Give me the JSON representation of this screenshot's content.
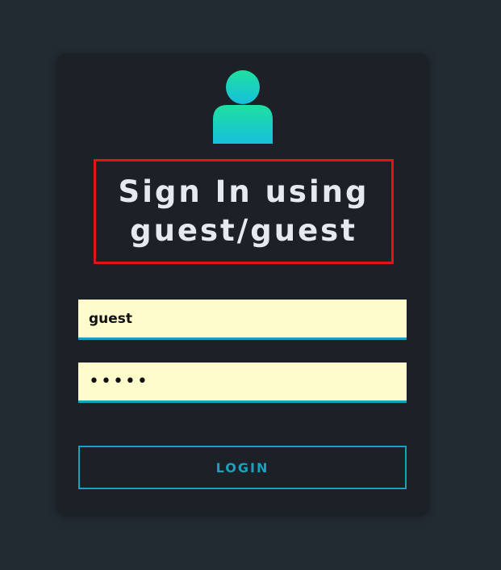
{
  "card": {
    "avatar_icon": "user-icon",
    "title_line1": "Sign In using",
    "title_line2": "guest/guest"
  },
  "form": {
    "username_value": "guest",
    "password_value": "guest",
    "login_label": "LOGIN"
  },
  "colors": {
    "background": "#232b32",
    "card": "#1b2127",
    "accent": "#17a3c0",
    "avatar_top": "#1fe0a0",
    "avatar_bottom": "#16bfdc",
    "input_bg": "#fefccc",
    "highlight_border": "#e0141a"
  }
}
